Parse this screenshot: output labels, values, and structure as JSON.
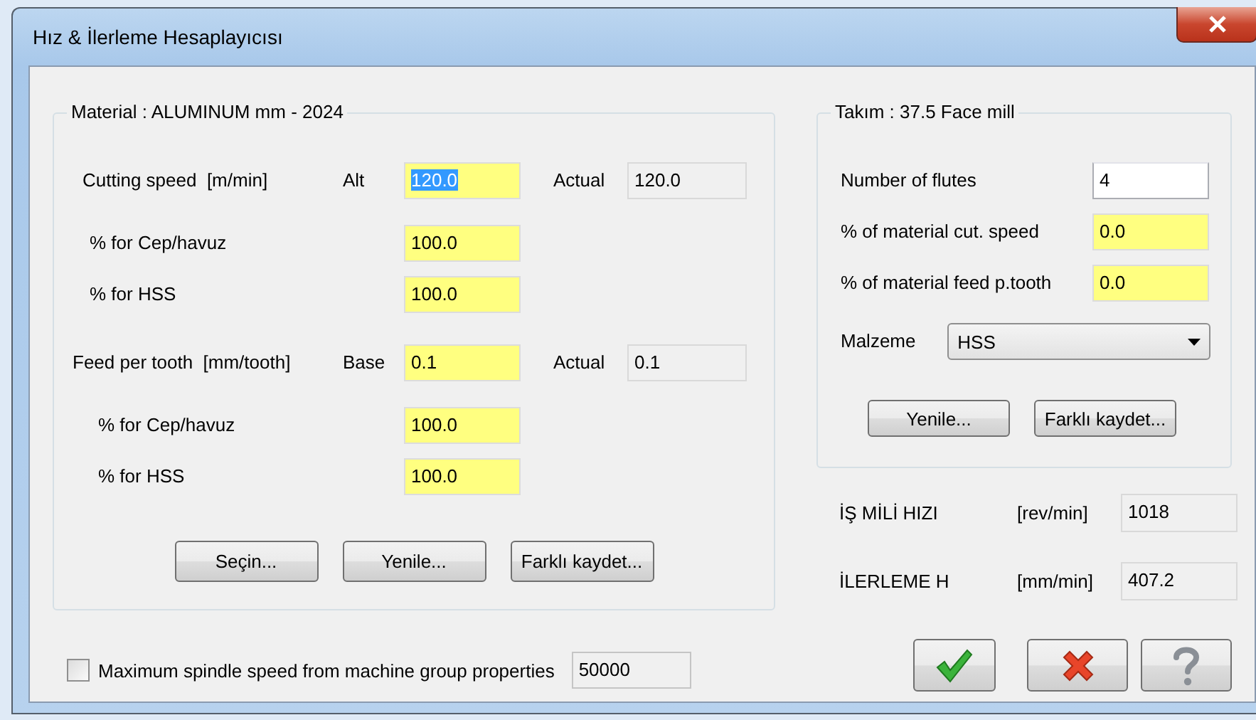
{
  "window": {
    "title": "Hız & İlerleme Hesaplayıcısı"
  },
  "material": {
    "legend": "Material : ALUMINUM mm - 2024",
    "sections": [
      {
        "label": "Cutting speed  [m/min]",
        "tag": "Alt",
        "value": "120.0",
        "text_selected": true,
        "actual_label": "Actual",
        "actual_value": "120.0",
        "adjustments": [
          {
            "label": "% for Cep/havuz",
            "value": "100.0"
          },
          {
            "label": "% for HSS",
            "value": "100.0"
          }
        ]
      },
      {
        "label": "Feed per tooth  [mm/tooth]",
        "tag": "Base",
        "value": "0.1",
        "text_selected": false,
        "actual_label": "Actual",
        "actual_value": "0.1",
        "adjustments": [
          {
            "label": "% for Cep/havuz",
            "value": "100.0"
          },
          {
            "label": "% for HSS",
            "value": "100.0"
          }
        ]
      }
    ],
    "buttons": [
      "Seçin...",
      "Yenile...",
      "Farklı kaydet..."
    ]
  },
  "tool": {
    "legend": "Takım : 37.5 Face mill",
    "fields": [
      {
        "label": "Number of flutes",
        "value": "4",
        "kind": "plain"
      },
      {
        "label": "% of material cut. speed",
        "value": "0.0",
        "kind": "highlighted"
      },
      {
        "label": "% of material feed p.tooth",
        "value": "0.0",
        "kind": "highlighted"
      }
    ],
    "material_select": {
      "label": "Malzeme",
      "value": "HSS"
    },
    "buttons": [
      "Yenile...",
      "Farklı kaydet..."
    ]
  },
  "results": [
    {
      "label": "İŞ MİLİ HIZI",
      "unit": "[rev/min]",
      "value": "1018"
    },
    {
      "label": "İLERLEME H",
      "unit": "[mm/min]",
      "value": "407.2"
    }
  ],
  "spindle_limit": {
    "label": "Maximum spindle speed from machine group properties",
    "checked": false,
    "value": "50000"
  },
  "dialog_buttons": [
    {
      "kind": "ok"
    },
    {
      "kind": "cancel"
    },
    {
      "kind": "help"
    }
  ]
}
